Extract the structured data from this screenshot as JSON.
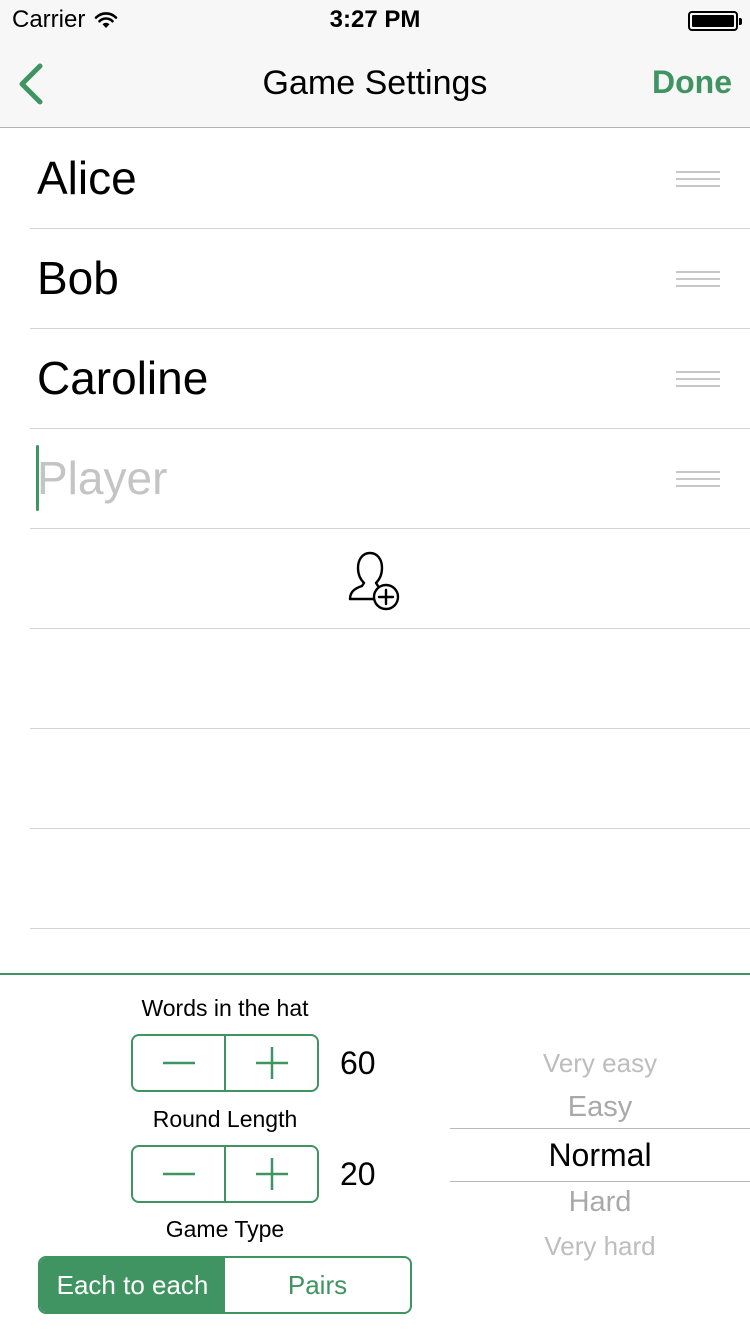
{
  "status_bar": {
    "carrier": "Carrier",
    "time": "3:27 PM"
  },
  "nav": {
    "title": "Game Settings",
    "done_label": "Done"
  },
  "players": [
    "Alice",
    "Bob",
    "Caroline"
  ],
  "new_player_placeholder": "Player",
  "settings": {
    "words_label": "Words in the hat",
    "words_value": "60",
    "round_label": "Round Length",
    "round_value": "20",
    "game_type_label": "Game Type",
    "game_types": [
      "Each to each",
      "Pairs"
    ],
    "game_type_selected": "Each to each",
    "difficulty_options": [
      "Very easy",
      "Easy",
      "Normal",
      "Hard",
      "Very hard"
    ],
    "difficulty_selected": "Normal"
  },
  "colors": {
    "accent": "#3f9461",
    "separator": "#d3d3d3",
    "placeholder": "#c4c4c4"
  },
  "icons": {
    "back": "chevron-left-icon",
    "add_player": "add-user-icon",
    "reorder": "reorder-handle-icon"
  }
}
